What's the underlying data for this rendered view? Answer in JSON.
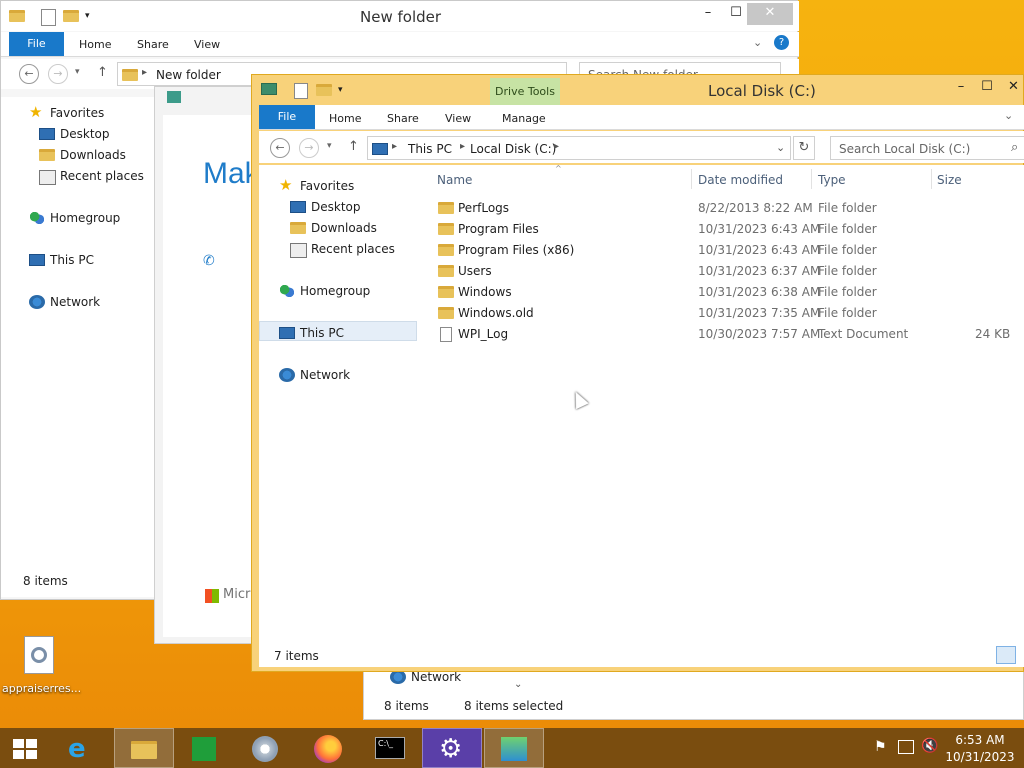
{
  "desktop": {
    "icon_label": "appraiserres..."
  },
  "back_window": {
    "title": "New folder",
    "tabs": {
      "file": "File",
      "home": "Home",
      "share": "Share",
      "view": "View"
    },
    "address": "New folder",
    "search_placeholder": "Search New folder",
    "nav": {
      "favorites": "Favorites",
      "desktop": "Desktop",
      "downloads": "Downloads",
      "recent": "Recent places",
      "homegroup": "Homegroup",
      "this_pc": "This PC",
      "network": "Network"
    },
    "status": "8 items",
    "preview_text": "Mak",
    "preview_brand": "Micr"
  },
  "third_window": {
    "nav_network": "Network",
    "status_items": "8 items",
    "status_selected": "8 items selected"
  },
  "front_window": {
    "title": "Local Disk (C:)",
    "context_tab": "Drive Tools",
    "tabs": {
      "file": "File",
      "home": "Home",
      "share": "Share",
      "view": "View",
      "manage": "Manage"
    },
    "breadcrumb": [
      "This PC",
      "Local Disk (C:)"
    ],
    "search_placeholder": "Search Local Disk (C:)",
    "nav": {
      "favorites": "Favorites",
      "desktop": "Desktop",
      "downloads": "Downloads",
      "recent": "Recent places",
      "homegroup": "Homegroup",
      "this_pc": "This PC",
      "network": "Network"
    },
    "columns": {
      "name": "Name",
      "date": "Date modified",
      "type": "Type",
      "size": "Size"
    },
    "files": [
      {
        "name": "PerfLogs",
        "date": "8/22/2013 8:22 AM",
        "type": "File folder",
        "size": "",
        "icon": "folder-icon"
      },
      {
        "name": "Program Files",
        "date": "10/31/2023 6:43 AM",
        "type": "File folder",
        "size": "",
        "icon": "folder-icon"
      },
      {
        "name": "Program Files (x86)",
        "date": "10/31/2023 6:43 AM",
        "type": "File folder",
        "size": "",
        "icon": "folder-icon"
      },
      {
        "name": "Users",
        "date": "10/31/2023 6:37 AM",
        "type": "File folder",
        "size": "",
        "icon": "folder-icon"
      },
      {
        "name": "Windows",
        "date": "10/31/2023 6:38 AM",
        "type": "File folder",
        "size": "",
        "icon": "folder-icon"
      },
      {
        "name": "Windows.old",
        "date": "10/31/2023 7:35 AM",
        "type": "File folder",
        "size": "",
        "icon": "folder-icon"
      },
      {
        "name": "WPI_Log",
        "date": "10/30/2023 7:57 AM",
        "type": "Text Document",
        "size": "24 KB",
        "icon": "text-document-icon"
      }
    ],
    "status": "7 items"
  },
  "taskbar": {
    "time": "6:53 AM",
    "date": "10/31/2023",
    "apps": [
      "start-icon",
      "internet-explorer-icon",
      "file-explorer-icon",
      "store-icon",
      "media-icon",
      "firefox-icon",
      "command-prompt-icon",
      "settings-icon",
      "installer-icon"
    ]
  }
}
